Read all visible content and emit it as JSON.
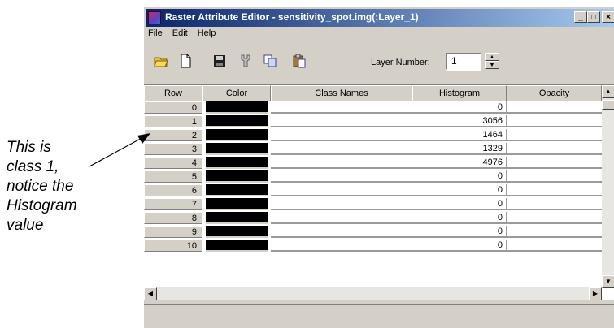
{
  "annotation": {
    "lines": [
      "This is",
      "class 1,",
      "notice the",
      "Histogram",
      "value"
    ]
  },
  "window": {
    "title": "Raster Attribute Editor - sensitivity_spot.img(:Layer_1)",
    "controls": {
      "minimize": "_",
      "maximize": "□",
      "close": "×"
    }
  },
  "menu": {
    "file": "File",
    "edit": "Edit",
    "help": "Help"
  },
  "toolbar": {
    "icons": [
      "open-folder-icon",
      "new-document-icon",
      "save-disk-icon",
      "tool-icon",
      "copy-icon",
      "paste-icon"
    ],
    "layer_label": "Layer Number:",
    "layer_value": "1"
  },
  "table": {
    "headers": {
      "row": "Row",
      "color": "Color",
      "class_names": "Class Names",
      "histogram": "Histogram",
      "opacity": "Opacity"
    },
    "rows": [
      {
        "row": "0",
        "histogram": "0"
      },
      {
        "row": "1",
        "histogram": "3056"
      },
      {
        "row": "2",
        "histogram": "1464"
      },
      {
        "row": "3",
        "histogram": "1329"
      },
      {
        "row": "4",
        "histogram": "4976"
      },
      {
        "row": "5",
        "histogram": "0"
      },
      {
        "row": "6",
        "histogram": "0"
      },
      {
        "row": "7",
        "histogram": "0"
      },
      {
        "row": "8",
        "histogram": "0"
      },
      {
        "row": "9",
        "histogram": "0"
      },
      {
        "row": "10",
        "histogram": "0"
      }
    ]
  },
  "colors": {
    "title_start": "#0a246a",
    "title_end": "#a6caf0",
    "face": "#d4d0c8",
    "class_color": "#000000"
  }
}
